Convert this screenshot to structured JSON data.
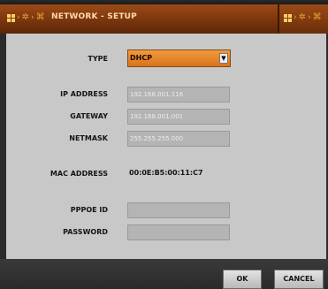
{
  "window": {
    "title": "NETWORK - SETUP"
  },
  "icons": {
    "breadcrumb_left": [
      "grid-icon",
      "arrow-right-icon",
      "gear-icon",
      "arrow-right-icon",
      "network-icon"
    ],
    "breadcrumb_right": [
      "grid-icon",
      "arrow-right-icon",
      "gear-icon",
      "arrow-right-icon",
      "network-icon"
    ]
  },
  "form": {
    "type": {
      "label": "TYPE",
      "value": "DHCP"
    },
    "ip_address": {
      "label": "IP ADDRESS",
      "value": "192.168.001.116"
    },
    "gateway": {
      "label": "GATEWAY",
      "value": "192.168.001.001"
    },
    "netmask": {
      "label": "NETMASK",
      "value": "255.255.255.000"
    },
    "mac_address": {
      "label": "MAC ADDRESS",
      "value": "00:0E:B5:00:11:C7"
    },
    "pppoe_id": {
      "label": "PPPOE ID",
      "value": ""
    },
    "password": {
      "label": "PASSWORD",
      "value": ""
    }
  },
  "buttons": {
    "ok": "OK",
    "cancel": "CANCEL"
  },
  "colors": {
    "title_bar": "#8a3e10",
    "title_text": "#ffd9b0",
    "panel_bg": "#c8c8c8",
    "select_accent": "#f29a3e",
    "bottom_bar": "#2f2f2f"
  }
}
